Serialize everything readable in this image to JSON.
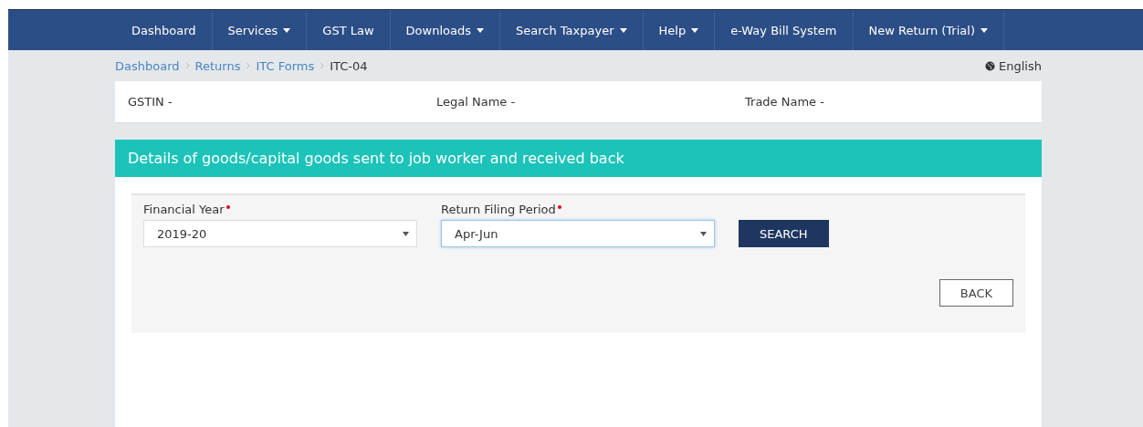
{
  "nav": [
    {
      "label": "Dashboard",
      "dropdown": false
    },
    {
      "label": "Services",
      "dropdown": true
    },
    {
      "label": "GST Law",
      "dropdown": false
    },
    {
      "label": "Downloads",
      "dropdown": true
    },
    {
      "label": "Search Taxpayer",
      "dropdown": true
    },
    {
      "label": "Help",
      "dropdown": true
    },
    {
      "label": "e-Way Bill System",
      "dropdown": false
    },
    {
      "label": "New Return (Trial)",
      "dropdown": true
    }
  ],
  "breadcrumb": [
    {
      "label": "Dashboard",
      "current": false
    },
    {
      "label": "Returns",
      "current": false
    },
    {
      "label": "ITC Forms",
      "current": false
    },
    {
      "label": "ITC-04",
      "current": true
    }
  ],
  "language": "English",
  "taxpayer_info": [
    "GSTIN -",
    "Legal Name -",
    "Trade Name -"
  ],
  "section_title": "Details of goods/capital goods sent to job worker and received back",
  "fields": [
    {
      "label": "Financial Year",
      "required": true,
      "value": "2019-20",
      "focused": false
    },
    {
      "label": "Return Filing Period",
      "required": true,
      "value": "Apr-Jun",
      "focused": true
    }
  ],
  "buttons": [
    {
      "label": "SEARCH",
      "kind": "primary"
    },
    {
      "label": "BACK",
      "kind": "secondary"
    }
  ]
}
